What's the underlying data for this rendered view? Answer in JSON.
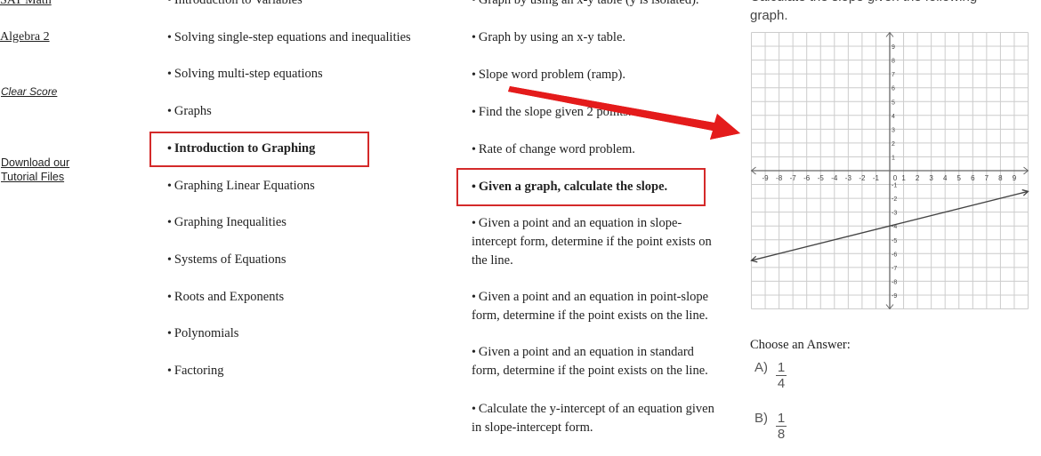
{
  "sidebar": {
    "links": [
      "SAT Math",
      "Algebra 2"
    ],
    "clear_score": "Clear Score",
    "download": [
      "Download our ",
      "Tutorial Files"
    ]
  },
  "topics_col1": [
    "Introduction to Variables",
    "Solving single-step equations and inequalities",
    "Solving multi-step equations",
    "Graphs",
    "Introduction to Graphing",
    "Graphing Linear Equations",
    "Graphing Inequalities",
    "Systems of Equations",
    "Roots and Exponents",
    "Polynomials",
    "Factoring"
  ],
  "topics_col2": [
    [
      "Graph by using an x-y table (y is isolated)."
    ],
    [
      "Graph by using an x-y table."
    ],
    [
      "Slope word problem (ramp)."
    ],
    [
      "Find the slope given 2 points."
    ],
    [
      "Rate of change word problem."
    ],
    [
      "Given a graph, calculate the slope."
    ],
    [
      "Given a point and an equation in slope-",
      "intercept form, determine if the point exists on",
      "the line."
    ],
    [
      "Given a point and an equation in point-slope",
      "form, determine if the point exists on the line."
    ],
    [
      "Given a point and an equation in standard",
      "form, determine if the point exists on the line."
    ],
    [
      "Calculate the y-intercept of an equation given",
      "in slope-intercept form."
    ]
  ],
  "highlight_color": "#d42a2a",
  "question": {
    "text": [
      "Calculate the slope given the following",
      "graph."
    ],
    "choose_label": "Choose an Answer:",
    "answers": [
      {
        "letter": "A)",
        "numerator": "1",
        "denominator": "4"
      },
      {
        "letter": "B)",
        "numerator": "1",
        "denominator": "8"
      }
    ]
  },
  "chart_data": {
    "type": "line",
    "xlim": [
      -10,
      10
    ],
    "ylim": [
      -10,
      10
    ],
    "grid": true,
    "x_ticks": [
      -9,
      -8,
      -7,
      -6,
      -5,
      -4,
      -3,
      -2,
      -1,
      0,
      1,
      2,
      3,
      4,
      5,
      6,
      7,
      8,
      9
    ],
    "y_ticks": [
      -9,
      -8,
      -7,
      -6,
      -5,
      -4,
      -3,
      -2,
      -1,
      1,
      2,
      3,
      4,
      5,
      6,
      7,
      8,
      9
    ],
    "series": [
      {
        "points": [
          [
            -10,
            -6.5
          ],
          [
            10,
            -1.5
          ]
        ]
      }
    ]
  }
}
